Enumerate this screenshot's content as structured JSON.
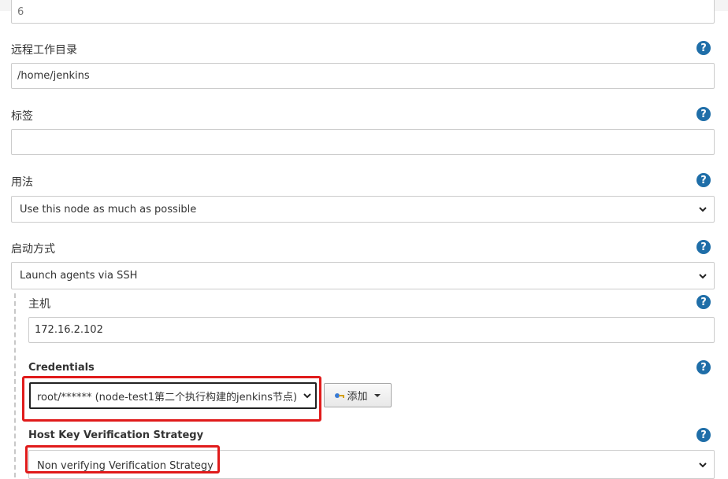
{
  "top_field": {
    "value": "6"
  },
  "remote_dir": {
    "label": "远程工作目录",
    "value": "/home/jenkins"
  },
  "labels": {
    "label": "标签",
    "value": ""
  },
  "usage": {
    "label": "用法",
    "selected": "Use this node as much as possible"
  },
  "launch": {
    "label": "启动方式",
    "selected": "Launch agents via SSH"
  },
  "host": {
    "label": "主机",
    "value": "172.16.2.102"
  },
  "credentials": {
    "label": "Credentials",
    "selected": "root/****** (node-test1第二个执行构建的jenkins节点)",
    "add_button": "添加"
  },
  "host_key": {
    "label": "Host Key Verification Strategy",
    "selected": "Non verifying Verification Strategy"
  },
  "help_glyph": "?",
  "colors": {
    "help": "#1f6ea8",
    "highlight": "#e01b1b"
  }
}
